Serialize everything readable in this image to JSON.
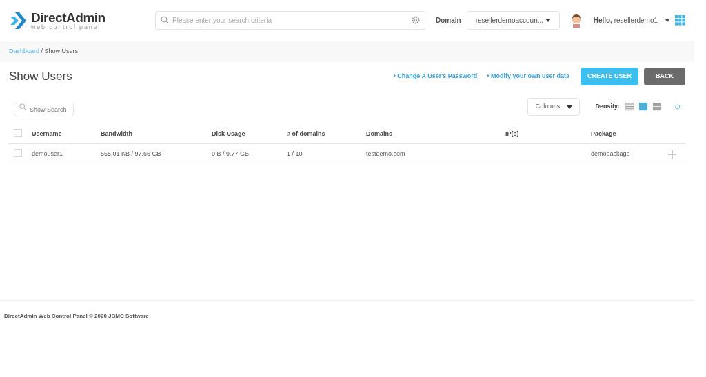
{
  "logo": {
    "name": "DirectAdmin",
    "tagline": "web control panel"
  },
  "search": {
    "placeholder": "Please enter your search criteria"
  },
  "domain": {
    "label": "Domain",
    "value": "resellerdemoaccoun..."
  },
  "user": {
    "greeting": "**Hello,** resellerdemo1"
  },
  "breadcrumb": [
    {
      "label": "Dashboard",
      "kind": "link"
    },
    {
      "label": " / Show Users",
      "kind": "current"
    }
  ],
  "page_title": "Show Users",
  "links": [
    "• Change A User's Password",
    "• Modify your own user data"
  ],
  "buttons": [
    {
      "label": "CREATE USER",
      "kind": "primary"
    },
    {
      "label": "BACK",
      "kind": "secondary"
    }
  ],
  "table_search": {
    "placeholder": "Show Search"
  },
  "columns_button": "Columns",
  "density": {
    "label": "Density:",
    "options": [
      {
        "selected": false
      },
      {
        "selected": true
      },
      {
        "selected": false
      }
    ]
  },
  "table": {
    "all_checked": false,
    "columns": [
      "Username",
      "Bandwidth",
      "Disk Usage",
      "# of domains",
      "Domains",
      "IP(s)",
      "Package"
    ],
    "rows": [
      {
        "checked": false,
        "cells": [
          "demouser1",
          "555.01 KB / 97.66 GB",
          "0 B / 9.77 GB",
          "1 / 10",
          "testdemo.com",
          "",
          "demopackage"
        ]
      }
    ]
  },
  "footer": "DirectAdmin Web Control Panel © 2020 JBMC Software"
}
